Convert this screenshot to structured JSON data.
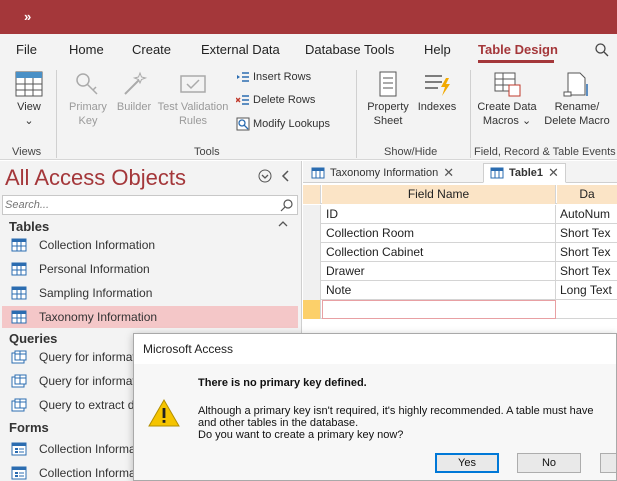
{
  "titlebar": {
    "qat_label": "»"
  },
  "menu": {
    "items": [
      "File",
      "Home",
      "Create",
      "External Data",
      "Database Tools",
      "Help",
      "Table Design"
    ],
    "active": "Table Design"
  },
  "ribbon": {
    "view": {
      "label": "View",
      "arrow": "⌄"
    },
    "primary_key": {
      "line1": "Primary",
      "line2": "Key"
    },
    "builder": {
      "label": "Builder"
    },
    "test_validation": {
      "line1": "Test Validation",
      "line2": "Rules"
    },
    "insert_rows": "Insert Rows",
    "delete_rows": "Delete Rows",
    "modify_lookups": "Modify Lookups",
    "property_sheet": {
      "line1": "Property",
      "line2": "Sheet"
    },
    "indexes": {
      "label": "Indexes"
    },
    "create_data_macros": {
      "line1": "Create Data",
      "line2": "Macros ⌄"
    },
    "rename_delete_macro": {
      "line1": "Rename/",
      "line2": "Delete Macro"
    },
    "groups": {
      "views": "Views",
      "tools": "Tools",
      "show_hide": "Show/Hide",
      "field_events": "Field, Record & Table Events"
    }
  },
  "nav": {
    "title": "All Access Objects",
    "search_placeholder": "Search...",
    "sections": {
      "tables": "Tables",
      "queries": "Queries",
      "forms": "Forms"
    },
    "tables": [
      "Collection Information",
      "Personal Information",
      "Sampling Information",
      "Taxonomy Information"
    ],
    "queries": [
      "Query for informat",
      "Query for informat",
      "Query to extract da"
    ],
    "forms": [
      "Collection Informa",
      "Collection Informa"
    ]
  },
  "document": {
    "tabs": [
      {
        "label": "Taxonomy Information",
        "close": "✕"
      },
      {
        "label": "Table1",
        "close": "✕"
      }
    ],
    "grid": {
      "headers": [
        "Field Name",
        "Da"
      ],
      "rows": [
        {
          "field": "ID",
          "type": "AutoNum"
        },
        {
          "field": "Collection Room",
          "type": "Short Tex"
        },
        {
          "field": "Collection Cabinet",
          "type": "Short Tex"
        },
        {
          "field": "Drawer",
          "type": "Short Tex"
        },
        {
          "field": "Note",
          "type": "Long Text"
        }
      ]
    }
  },
  "dialog": {
    "title": "Microsoft Access",
    "main": "There is no primary key defined.",
    "line1": "Although a primary key isn't required, it's highly recommended. A table must have",
    "line2": "and other tables in the database.",
    "line3": "Do you want to create a primary key now?",
    "buttons": {
      "yes": "Yes",
      "no": "No"
    }
  },
  "colors": {
    "accent": "#a4373a",
    "selected_nav": "#f4c7c8",
    "grid_header": "#fbe4c6"
  }
}
